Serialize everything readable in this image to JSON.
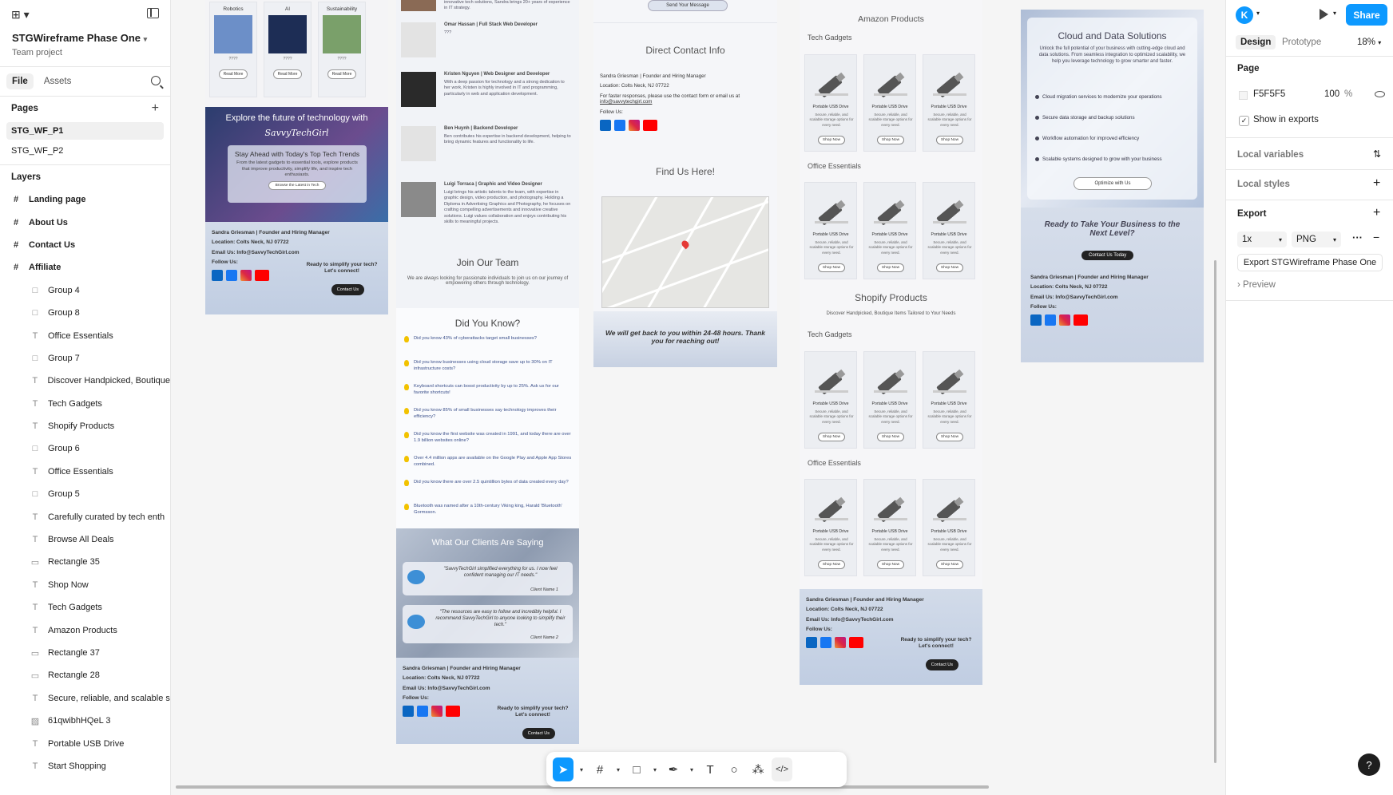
{
  "project": {
    "name": "STGWireframe Phase One",
    "team": "Team project"
  },
  "left_tabs": [
    "File",
    "Assets"
  ],
  "pages_header": "Pages",
  "pages": [
    "STG_WF_P1",
    "STG_WF_P2"
  ],
  "layers_header": "Layers",
  "top_layers": [
    "Landing page",
    "About Us",
    "Contact Us",
    "Affiliate"
  ],
  "sub_layers": [
    {
      "icon": "frame",
      "name": "Group 4"
    },
    {
      "icon": "frame",
      "name": "Group 8"
    },
    {
      "icon": "text",
      "name": "Office Essentials"
    },
    {
      "icon": "frame",
      "name": "Group 7"
    },
    {
      "icon": "text",
      "name": "Discover Handpicked, Boutique"
    },
    {
      "icon": "text",
      "name": "Tech Gadgets"
    },
    {
      "icon": "text",
      "name": "Shopify Products"
    },
    {
      "icon": "frame",
      "name": "Group 6"
    },
    {
      "icon": "text",
      "name": "Office Essentials"
    },
    {
      "icon": "frame",
      "name": "Group 5"
    },
    {
      "icon": "text",
      "name": "Carefully curated by tech enth"
    },
    {
      "icon": "text",
      "name": "Browse All Deals"
    },
    {
      "icon": "rect",
      "name": "Rectangle 35"
    },
    {
      "icon": "text",
      "name": "Shop Now"
    },
    {
      "icon": "text",
      "name": "Tech Gadgets"
    },
    {
      "icon": "text",
      "name": "Amazon Products"
    },
    {
      "icon": "rect",
      "name": "Rectangle 37"
    },
    {
      "icon": "rect",
      "name": "Rectangle 28"
    },
    {
      "icon": "text",
      "name": "Secure, reliable, and scalable s"
    },
    {
      "icon": "image",
      "name": "61qwibhHQeL 3"
    },
    {
      "icon": "text",
      "name": "Portable USB Drive"
    },
    {
      "icon": "text",
      "name": "Start Shopping"
    }
  ],
  "right": {
    "avatar": "K",
    "share": "Share",
    "tabs": [
      "Design",
      "Prototype"
    ],
    "zoom": "18%",
    "page_label": "Page",
    "page_color": "F5F5F5",
    "page_opacity": "100",
    "percent": "%",
    "show_exports": "Show in exports",
    "local_variables": "Local variables",
    "local_styles": "Local styles",
    "export_label": "Export",
    "scale": "1x",
    "format": "PNG",
    "export_button": "Export STGWireframe Phase One",
    "preview": "Preview",
    "help": "?"
  },
  "frames": {
    "f1": {
      "cards": [
        "Robotics",
        "AI",
        "Sustainability"
      ],
      "card_sub": "????",
      "read_more": "Read More",
      "hero_title": "Explore the future of technology with",
      "hero_brand": "SavvyTechGirl",
      "hero_h2": "Stay Ahead with Today's Top Tech Trends",
      "hero_body": "From the latest gadgets to essential tools, explore products that improve productivity, simplify life, and inspire tech enthusiasts.",
      "hero_btn": "Browse the Latest in Tech"
    },
    "footer": {
      "name": "Sandra Griesman | Founder and Hiring Manager",
      "location": "Location: Colts Neck, NJ 07722",
      "email": "Email Us: Info@SavvyTechGirl.com",
      "follow": "Follow Us:",
      "ready": "Ready to simplify your tech? Let's connect!",
      "contact": "Contact Us"
    },
    "f2": {
      "team": [
        {
          "name": "",
          "desc": "innovative tech solutions, Sandra brings 20+ years of experience in IT strategy."
        },
        {
          "name": "Omar Hassan | Full Stack Web Developer",
          "desc": "???"
        },
        {
          "name": "Kristen Nguyen | Web Designer and Developer",
          "desc": "With a deep passion for technology and a strong dedication to her work, Kristen is highly involved in IT and programming, particularly in web and application development."
        },
        {
          "name": "Ben Huynh | Backend Developer",
          "desc": "Ben contributes his expertise in backend development, helping to bring dynamic features and functionality to life."
        },
        {
          "name": "Luigi Torraca | Graphic and Video Designer",
          "desc": "Luigi brings his artistic talents to the team, with expertise in graphic design, video production, and photography. Holding a Diploma in Advertising Graphics and Photography, he focuses on crafting compelling advertisements and innovative creative solutions. Luigi values collaboration and enjoys contributing his skills to meaningful projects."
        }
      ],
      "join": "Join Our Team",
      "join_body": "We are always looking for passionate individuals to join us on our journey of empowering others through technology.",
      "dyk": "Did You Know?",
      "facts": [
        "Did you know 43% of cyberattacks target small businesses?",
        "Did you know businesses using cloud storage save up to 30% on IT infrastructure costs?",
        "Keyboard shortcuts can boost productivity by up to 25%. Ask us for our favorite shortcuts!",
        "Did you know 85% of small businesses say technology improves their efficiency?",
        "Did you know the first website was created in 1991, and today there are over 1.9 billion websites online?",
        "Over 4.4 million apps are available on the Google Play and Apple App Stores combined.",
        "Did you know there are over 2.5 quintillion bytes of data created every day?",
        "Bluetooth was named after a 10th-century Viking king, Harald 'Bluetooth' Gormsson."
      ],
      "clients": "What Our Clients Are Saying",
      "q1": "\"SavvyTechGirl simplified everything for us. I now feel confident managing our IT needs.\"",
      "c1": "Client Name 1",
      "q2": "\"The resources are easy to follow and incredibly helpful. I recommend SavvyTechGirl to anyone looking to simplify their tech.\"",
      "c2": "Client Name 2"
    },
    "f3": {
      "send": "Send Your Message",
      "direct": "Direct Contact Info",
      "name": "Sandra Griesman | Founder and Hiring Manager",
      "loc": "Location: Colts Neck, NJ 07722",
      "faster": "For faster responses, please use the contact form or email us at",
      "email": "info@savvytechgirl.com",
      "follow": "Follow Us:",
      "find": "Find Us Here!",
      "reply": "We will get back to you within 24-48 hours. Thank you for reaching out!"
    },
    "f4": {
      "amazon": "Amazon Products",
      "tech": "Tech Gadgets",
      "office": "Office Essentials",
      "shopify": "Shopify Products",
      "shopify_sub": "Discover Handpicked, Boutique Items Tailored to Your Needs",
      "prod_title": "Portable USB Drive",
      "prod_desc": "Secure, reliable, and scalable storage options for every need.",
      "shop": "Shop Now"
    },
    "f5": {
      "title": "Cloud and Data Solutions",
      "intro": "Unlock the full potential of your business with cutting-edge cloud and data solutions. From seamless integration to optimized scalability, we help you leverage technology to grow smarter and faster.",
      "bullets": [
        "Cloud migration services to modernize your operations",
        "Secure data storage and backup solutions",
        "Workflow automation for improved efficiency",
        "Scalable systems designed to grow with your business"
      ],
      "btn": "Optimize with Us",
      "ready": "Ready to Take Your Business to the Next Level?",
      "contact_today": "Contact Us Today"
    }
  }
}
